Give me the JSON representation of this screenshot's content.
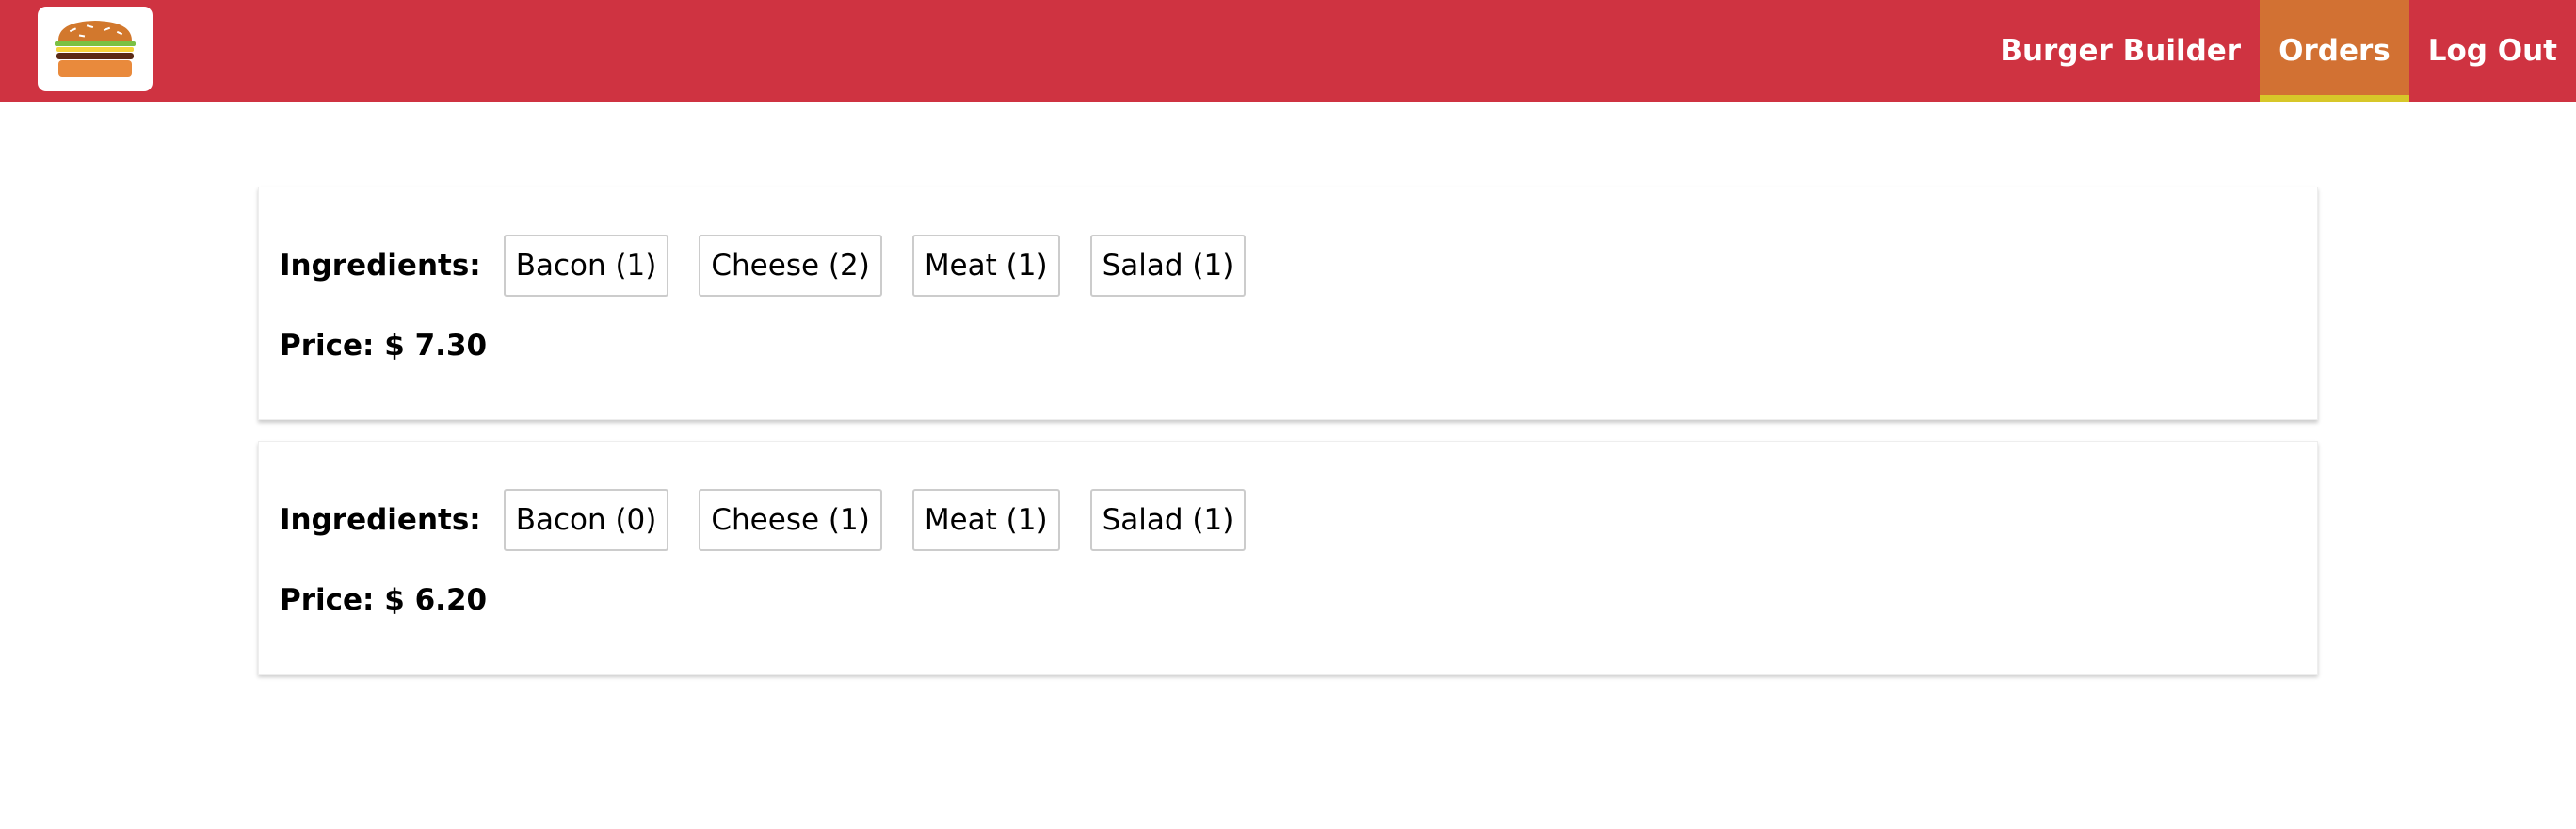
{
  "app": {
    "logo_icon": "burger-logo-icon"
  },
  "nav": {
    "items": [
      {
        "label": "Burger Builder",
        "active": false
      },
      {
        "label": "Orders",
        "active": true
      },
      {
        "label": "Log Out",
        "active": false
      }
    ]
  },
  "orders": [
    {
      "ingredients_label": "Ingredients:",
      "ingredients": [
        "Bacon (1)",
        "Cheese (2)",
        "Meat (1)",
        "Salad (1)"
      ],
      "price_label": "Price:",
      "price": "$ 7.30"
    },
    {
      "ingredients_label": "Ingredients:",
      "ingredients": [
        "Bacon (0)",
        "Cheese (1)",
        "Meat (1)",
        "Salad (1)"
      ],
      "price_label": "Price:",
      "price": "$ 6.20"
    }
  ],
  "colors": {
    "toolbar": "#cf3341",
    "nav_active": "#d27133",
    "nav_active_underline": "#d7c729"
  }
}
